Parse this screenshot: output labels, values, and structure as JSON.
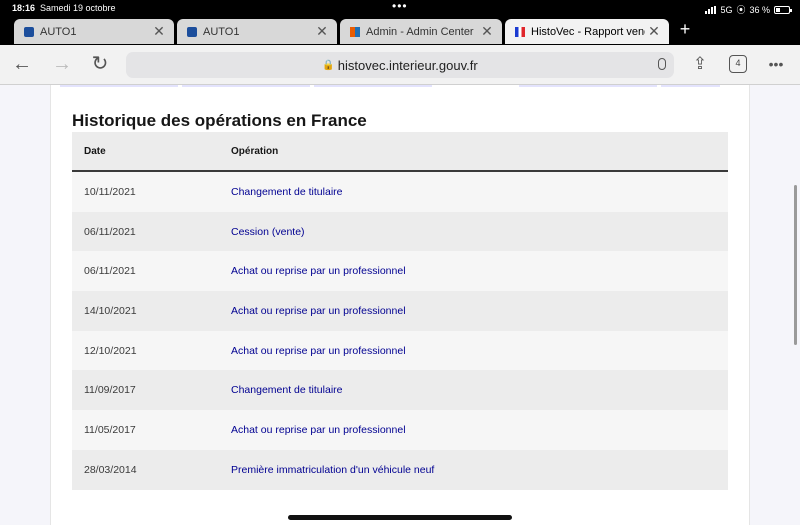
{
  "status": {
    "time": "18:16",
    "date": "Samedi 19 octobre",
    "network": "5G",
    "battery": "36 %"
  },
  "tabs": [
    {
      "label": "AUTO1",
      "icon": "auto1-favicon"
    },
    {
      "label": "AUTO1",
      "icon": "auto1-favicon"
    },
    {
      "label": "Admin - Admin Center",
      "icon": "admin-favicon"
    },
    {
      "label": "HistoVec - Rapport vendeur",
      "icon": "french-flag-favicon",
      "active": true
    }
  ],
  "toolbar": {
    "url": "histovec.interieur.gouv.fr",
    "tab_count": "4"
  },
  "page": {
    "heading": "Historique des opérations en France",
    "columns": [
      "Date",
      "Opération"
    ],
    "rows": [
      {
        "date": "10/11/2021",
        "operation": "Changement de titulaire"
      },
      {
        "date": "06/11/2021",
        "operation": "Cession (vente)"
      },
      {
        "date": "06/11/2021",
        "operation": "Achat ou reprise par un professionnel"
      },
      {
        "date": "14/10/2021",
        "operation": "Achat ou reprise par un professionnel"
      },
      {
        "date": "12/10/2021",
        "operation": "Achat ou reprise par un professionnel"
      },
      {
        "date": "11/09/2017",
        "operation": "Changement de titulaire"
      },
      {
        "date": "11/05/2017",
        "operation": "Achat ou reprise par un professionnel"
      },
      {
        "date": "28/03/2014",
        "operation": "Première immatriculation d'un véhicule neuf"
      }
    ]
  },
  "colors": {
    "link": "#000091",
    "heading": "#161616"
  }
}
